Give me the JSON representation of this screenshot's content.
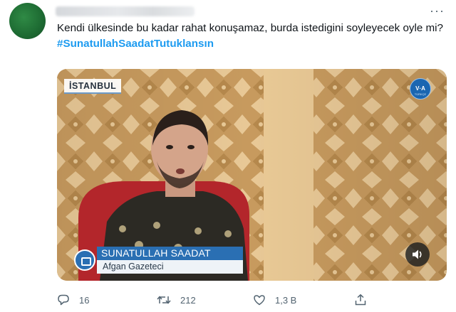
{
  "tweet": {
    "text": "Kendi ülkesinde bu kadar rahat konuşamaz, burda istedigini soyleyecek oyle mi?",
    "hashtag": "#SunatullahSaadatTutuklansın"
  },
  "video": {
    "location_tag": "İSTANBUL",
    "logo_text": "V·A",
    "logo_subtext": "TÜRKÇE",
    "caption_name": "SUNATULLAH SAADAT",
    "caption_title": "Afgan Gazeteci"
  },
  "actions": {
    "reply_count": "16",
    "retweet_count": "212",
    "like_count": "1,3 B"
  },
  "colors": {
    "accent": "#1d9bf0",
    "text": "#0f1419",
    "muted": "#536471",
    "caption_blue": "#2a6fb3"
  },
  "icons": [
    "avatar",
    "more-icon",
    "reply-icon",
    "retweet-icon",
    "like-icon",
    "share-icon",
    "sound-icon"
  ]
}
